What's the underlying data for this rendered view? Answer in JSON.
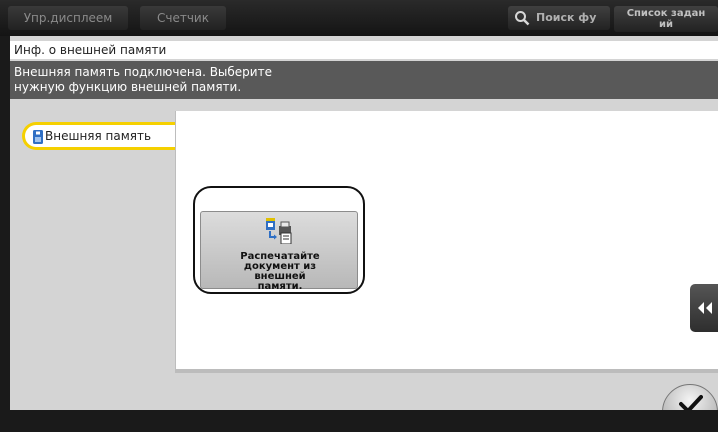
{
  "topbar": {
    "tab_display": "Упр.дисплеем",
    "tab_counter": "Счетчик",
    "search_label": "Поиск фу",
    "joblist_label_line1": "Список задан",
    "joblist_label_line2": "ий"
  },
  "header": {
    "title": "Инф. о внешней памяти"
  },
  "message": {
    "line1": "Внешняя память подключена. Выберите",
    "line2": "нужную функцию внешней памяти."
  },
  "sidebar": {
    "items": [
      {
        "label": "Внешняя память",
        "icon": "usb-memory-icon",
        "selected": true
      }
    ]
  },
  "functions": [
    {
      "icon": "print-from-usb-icon",
      "label_line1": "Распечатайте",
      "label_line2": "документ из",
      "label_line3": "внешней",
      "label_line4": "памяти."
    }
  ],
  "colors": {
    "accent_yellow": "#f5d000",
    "message_bg": "#595959",
    "panel_bg": "#d4d4d4"
  }
}
